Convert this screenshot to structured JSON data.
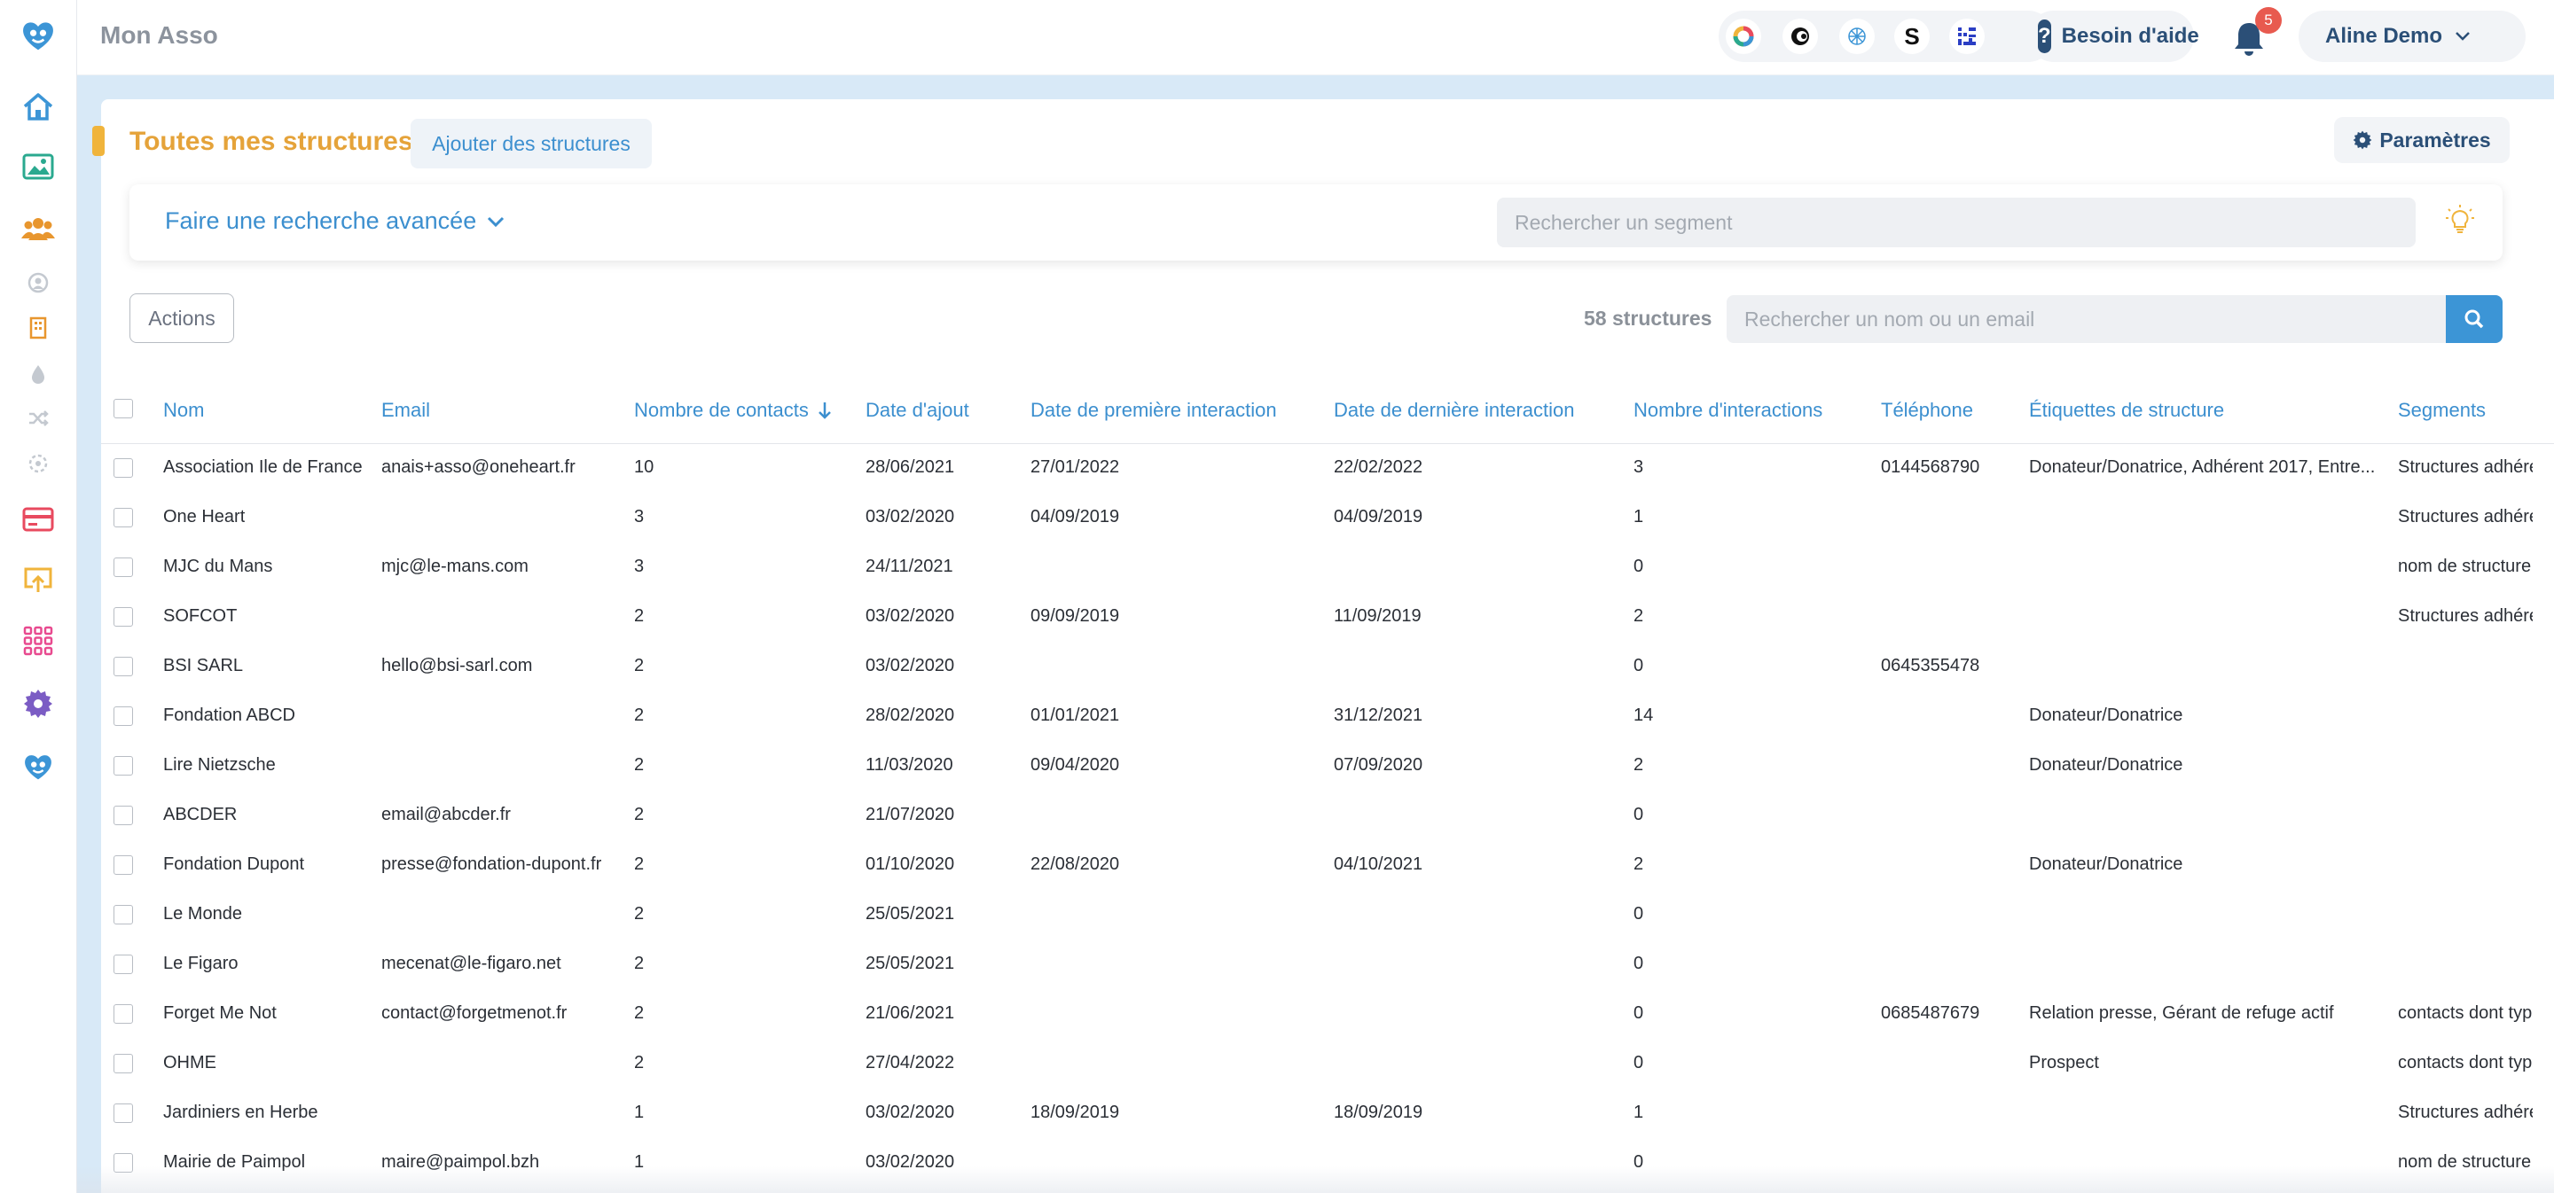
{
  "app": {
    "title": "Mon Asso"
  },
  "header": {
    "apps": [
      "color-ring-app-icon",
      "c-logo-app-icon",
      "spiral-app-icon",
      "s-letter-app-icon",
      "grid-letters-app-icon"
    ],
    "s_app_letter": "S",
    "help_icon": "?",
    "help_label": "Besoin d'aide",
    "notification_count": "5",
    "user_name": "Aline Demo"
  },
  "page": {
    "title": "Toutes mes structures",
    "add_button": "Ajouter des structures",
    "params_button": "Paramètres",
    "advanced_search": "Faire une recherche avancée",
    "segment_search_placeholder": "Rechercher un segment",
    "actions_button": "Actions",
    "count_label": "58 structures",
    "name_search_placeholder": "Rechercher un nom ou un email"
  },
  "colors": {
    "accent_blue": "#3c8fcf",
    "title_orange": "#e5a33a",
    "navy": "#2b4f77",
    "content_bg": "#d8e9f7",
    "badge_red": "#e85a4f"
  },
  "table": {
    "columns": [
      "Nom",
      "Email",
      "Nombre de contacts",
      "Date d'ajout",
      "Date de première interaction",
      "Date de dernière interaction",
      "Nombre d'interactions",
      "Téléphone",
      "Étiquettes de structure",
      "Segments"
    ],
    "rows": [
      {
        "nom": "Association Ile de France",
        "email": "anais+asso@oneheart.fr",
        "contacts": "10",
        "ajout": "28/06/2021",
        "premiere": "27/01/2022",
        "derniere": "22/02/2022",
        "interactions": "3",
        "telephone": "0144568790",
        "etiquettes": "Donateur/Donatrice, Adhérent 2017, Entre...",
        "segments": "Structures adhére"
      },
      {
        "nom": "One Heart",
        "email": "",
        "contacts": "3",
        "ajout": "03/02/2020",
        "premiere": "04/09/2019",
        "derniere": "04/09/2019",
        "interactions": "1",
        "telephone": "",
        "etiquettes": "",
        "segments": "Structures adhére"
      },
      {
        "nom": "MJC du Mans",
        "email": "mjc@le-mans.com",
        "contacts": "3",
        "ajout": "24/11/2021",
        "premiere": "",
        "derniere": "",
        "interactions": "0",
        "telephone": "",
        "etiquettes": "",
        "segments": "nom de structure"
      },
      {
        "nom": "SOFCOT",
        "email": "",
        "contacts": "2",
        "ajout": "03/02/2020",
        "premiere": "09/09/2019",
        "derniere": "11/09/2019",
        "interactions": "2",
        "telephone": "",
        "etiquettes": "",
        "segments": "Structures adhére"
      },
      {
        "nom": "BSI SARL",
        "email": "hello@bsi-sarl.com",
        "contacts": "2",
        "ajout": "03/02/2020",
        "premiere": "",
        "derniere": "",
        "interactions": "0",
        "telephone": "0645355478",
        "etiquettes": "",
        "segments": ""
      },
      {
        "nom": "Fondation ABCD",
        "email": "",
        "contacts": "2",
        "ajout": "28/02/2020",
        "premiere": "01/01/2021",
        "derniere": "31/12/2021",
        "interactions": "14",
        "telephone": "",
        "etiquettes": "Donateur/Donatrice",
        "segments": ""
      },
      {
        "nom": "Lire Nietzsche",
        "email": "",
        "contacts": "2",
        "ajout": "11/03/2020",
        "premiere": "09/04/2020",
        "derniere": "07/09/2020",
        "interactions": "2",
        "telephone": "",
        "etiquettes": "Donateur/Donatrice",
        "segments": ""
      },
      {
        "nom": "ABCDER",
        "email": "email@abcder.fr",
        "contacts": "2",
        "ajout": "21/07/2020",
        "premiere": "",
        "derniere": "",
        "interactions": "0",
        "telephone": "",
        "etiquettes": "",
        "segments": ""
      },
      {
        "nom": "Fondation Dupont",
        "email": "presse@fondation-dupont.fr",
        "contacts": "2",
        "ajout": "01/10/2020",
        "premiere": "22/08/2020",
        "derniere": "04/10/2021",
        "interactions": "2",
        "telephone": "",
        "etiquettes": "Donateur/Donatrice",
        "segments": ""
      },
      {
        "nom": "Le Monde",
        "email": "",
        "contacts": "2",
        "ajout": "25/05/2021",
        "premiere": "",
        "derniere": "",
        "interactions": "0",
        "telephone": "",
        "etiquettes": "",
        "segments": ""
      },
      {
        "nom": "Le Figaro",
        "email": "mecenat@le-figaro.net",
        "contacts": "2",
        "ajout": "25/05/2021",
        "premiere": "",
        "derniere": "",
        "interactions": "0",
        "telephone": "",
        "etiquettes": "",
        "segments": ""
      },
      {
        "nom": "Forget Me Not",
        "email": "contact@forgetmenot.fr",
        "contacts": "2",
        "ajout": "21/06/2021",
        "premiere": "",
        "derniere": "",
        "interactions": "0",
        "telephone": "0685487679",
        "etiquettes": "Relation presse, Gérant de refuge actif",
        "segments": "contacts dont typ"
      },
      {
        "nom": "OHME",
        "email": "",
        "contacts": "2",
        "ajout": "27/04/2022",
        "premiere": "",
        "derniere": "",
        "interactions": "0",
        "telephone": "",
        "etiquettes": "Prospect",
        "segments": "contacts dont typ"
      },
      {
        "nom": "Jardiniers en Herbe",
        "email": "",
        "contacts": "1",
        "ajout": "03/02/2020",
        "premiere": "18/09/2019",
        "derniere": "18/09/2019",
        "interactions": "1",
        "telephone": "",
        "etiquettes": "",
        "segments": "Structures adhére"
      },
      {
        "nom": "Mairie de Paimpol",
        "email": "maire@paimpol.bzh",
        "contacts": "1",
        "ajout": "03/02/2020",
        "premiere": "",
        "derniere": "",
        "interactions": "0",
        "telephone": "",
        "etiquettes": "",
        "segments": "nom de structure"
      }
    ]
  },
  "sidebar": {
    "items": [
      "logo-heart-icon",
      "home-icon",
      "image-icon",
      "contacts-icon",
      "person-icon",
      "building-icon",
      "drop-icon",
      "shuffle-icon",
      "target-icon",
      "card-icon",
      "upload-icon",
      "apps-grid-icon",
      "settings-icon",
      "heart-bottom-icon"
    ]
  }
}
